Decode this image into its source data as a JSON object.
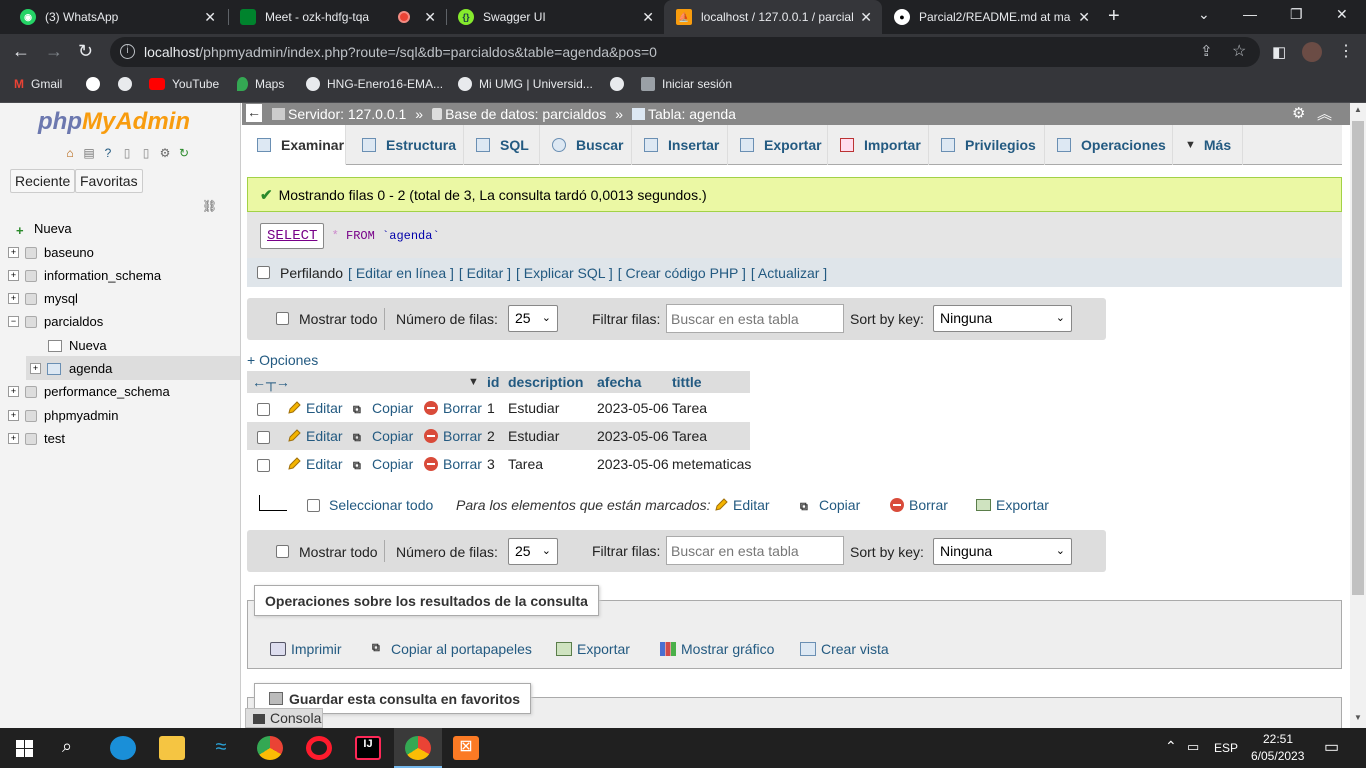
{
  "browser": {
    "tabs": [
      {
        "title": "(3) WhatsApp",
        "icon": "whatsapp-icon"
      },
      {
        "title": "Meet - ozk-hdfg-tqa",
        "icon": "meet-icon"
      },
      {
        "title": "Swagger UI",
        "icon": "swagger-icon"
      },
      {
        "title": "localhost / 127.0.0.1 / parcial",
        "icon": "phpmyadmin-icon"
      },
      {
        "title": "Parcial2/README.md at main",
        "icon": "github-icon"
      }
    ],
    "url_host": "localhost",
    "url_path": "/phpmyadmin/index.php?route=/sql&db=parcialdos&table=agenda&pos=0",
    "bookmarks": [
      "Gmail",
      "YouTube",
      "Maps",
      "HNG-Enero16-EMA...",
      "Mi UMG | Universid...",
      "Iniciar sesión"
    ]
  },
  "nav": {
    "logo_php": "php",
    "logo_my": "MyAdmin",
    "tab_recent": "Reciente",
    "tab_fav": "Favoritas",
    "tree": [
      "Nueva",
      "baseuno",
      "information_schema",
      "mysql",
      "parcialdos",
      "Nueva",
      "agenda",
      "performance_schema",
      "phpmyadmin",
      "test"
    ]
  },
  "breadcrumb": {
    "server": "Servidor: 127.0.0.1",
    "database": "Base de datos: parcialdos",
    "table": "Tabla: agenda",
    "sep": "»"
  },
  "tabs": [
    "Examinar",
    "Estructura",
    "SQL",
    "Buscar",
    "Insertar",
    "Exportar",
    "Importar",
    "Privilegios",
    "Operaciones",
    "Más"
  ],
  "message": "Mostrando filas 0 - 2 (total de 3, La consulta tardó 0,0013 segundos.)",
  "sql": {
    "kw_select": "SELECT",
    "star": "*",
    "kw_from": "FROM",
    "table": "`agenda`"
  },
  "profiling": {
    "label": "Perfilando",
    "links": [
      "[ Editar en línea ]",
      "[ Editar ]",
      "[ Explicar SQL ]",
      "[ Crear código PHP ]",
      "[ Actualizar ]"
    ]
  },
  "filters": {
    "show_all": "Mostrar todo",
    "rows_label": "Número de filas:",
    "rows_value": "25",
    "filter_label": "Filtrar filas:",
    "filter_placeholder": "Buscar en esta tabla",
    "sort_label": "Sort by key:",
    "sort_value": "Ninguna"
  },
  "options_link": "+ Opciones",
  "columns": [
    "id",
    "description",
    "afecha",
    "tittle"
  ],
  "row_actions": {
    "edit": "Editar",
    "copy": "Copiar",
    "delete": "Borrar"
  },
  "rows": [
    {
      "id": "1",
      "description": "Estudiar",
      "afecha": "2023-05-06",
      "tittle": "Tarea"
    },
    {
      "id": "2",
      "description": "Estudiar",
      "afecha": "2023-05-06",
      "tittle": "Tarea"
    },
    {
      "id": "3",
      "description": "Tarea",
      "afecha": "2023-05-06",
      "tittle": "metematicas"
    }
  ],
  "bulk": {
    "select_all": "Seleccionar todo",
    "marked_label": "Para los elementos que están marcados:",
    "edit": "Editar",
    "copy": "Copiar",
    "delete": "Borrar",
    "export": "Exportar"
  },
  "query_ops": {
    "legend": "Operaciones sobre los resultados de la consulta",
    "print": "Imprimir",
    "copy_clipboard": "Copiar al portapapeles",
    "export": "Exportar",
    "chart": "Mostrar gráfico",
    "view": "Crear vista"
  },
  "bookmark_legend": "Guardar esta consulta en favoritos",
  "console": "Consola",
  "taskbar": {
    "lang": "ESP",
    "time": "22:51",
    "date": "6/05/2023"
  }
}
